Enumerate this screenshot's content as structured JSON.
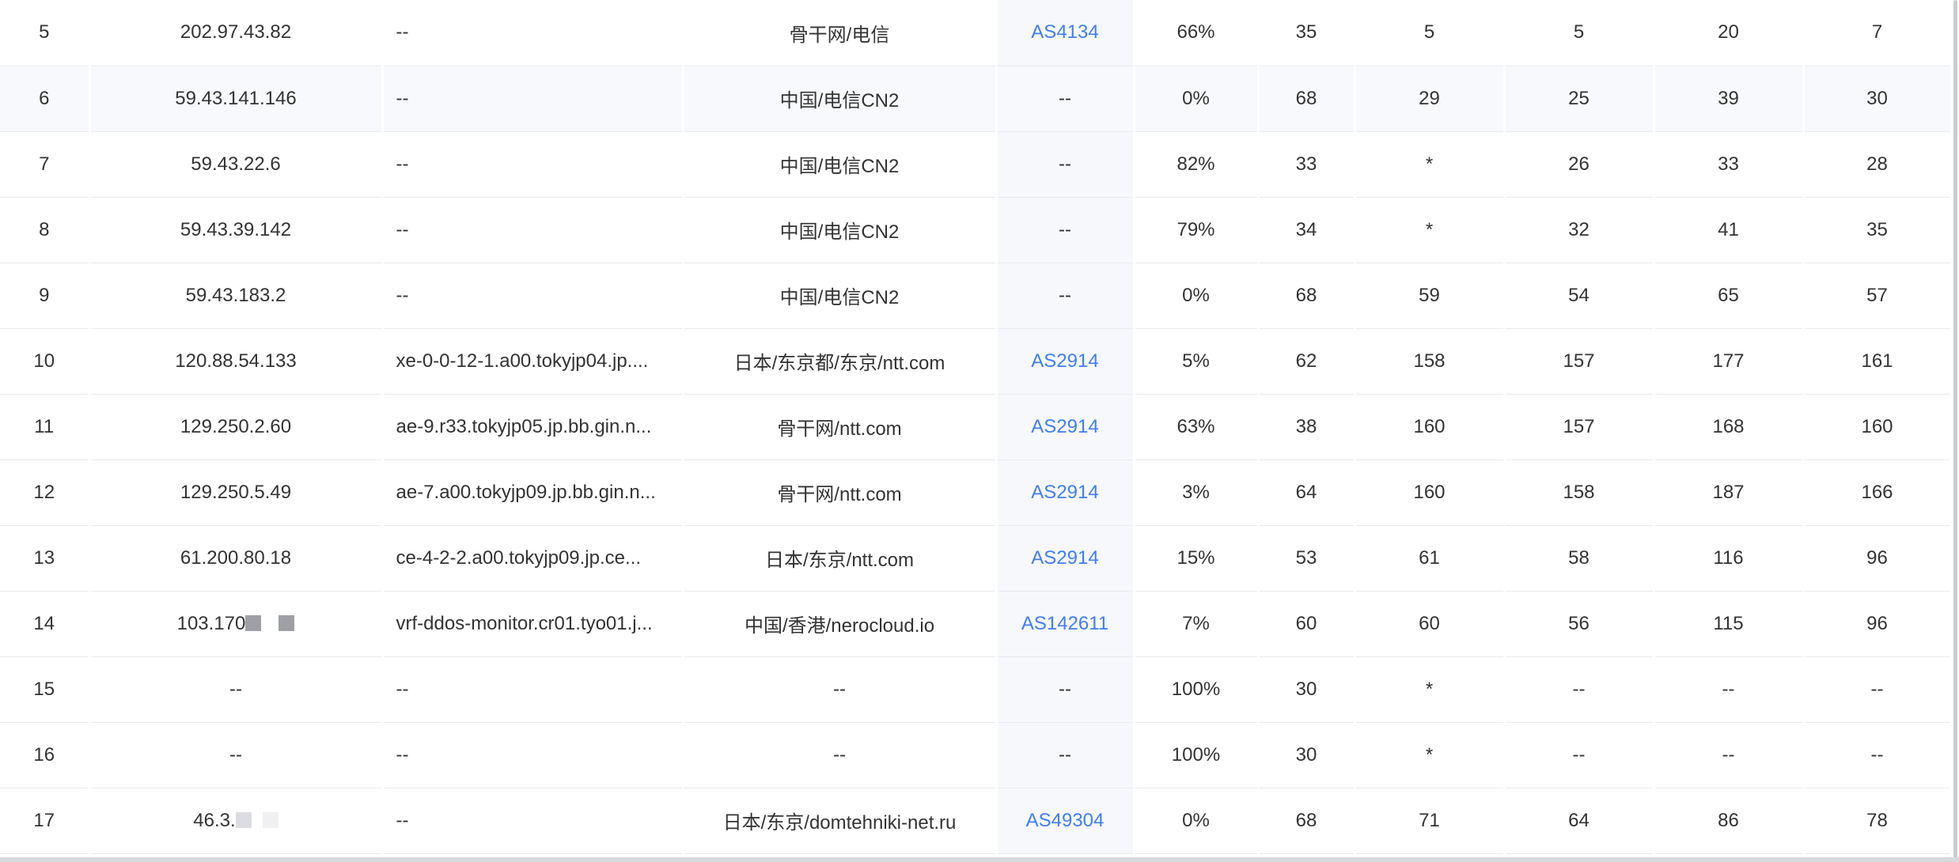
{
  "rows": [
    {
      "hop": "5",
      "ip": "202.97.43.82",
      "host": "--",
      "location": "骨干网/电信",
      "asn": "AS4134",
      "loss": "66%",
      "sent": "35",
      "last": "5",
      "best": "5",
      "worst": "20",
      "avg": "7"
    },
    {
      "hop": "6",
      "ip": "59.43.141.146",
      "host": "--",
      "location": "中国/电信CN2",
      "asn": "--",
      "loss": "0%",
      "sent": "68",
      "last": "29",
      "best": "25",
      "worst": "39",
      "avg": "30"
    },
    {
      "hop": "7",
      "ip": "59.43.22.6",
      "host": "--",
      "location": "中国/电信CN2",
      "asn": "--",
      "loss": "82%",
      "sent": "33",
      "last": "*",
      "best": "26",
      "worst": "33",
      "avg": "28"
    },
    {
      "hop": "8",
      "ip": "59.43.39.142",
      "host": "--",
      "location": "中国/电信CN2",
      "asn": "--",
      "loss": "79%",
      "sent": "34",
      "last": "*",
      "best": "32",
      "worst": "41",
      "avg": "35"
    },
    {
      "hop": "9",
      "ip": "59.43.183.2",
      "host": "--",
      "location": "中国/电信CN2",
      "asn": "--",
      "loss": "0%",
      "sent": "68",
      "last": "59",
      "best": "54",
      "worst": "65",
      "avg": "57"
    },
    {
      "hop": "10",
      "ip": "120.88.54.133",
      "host": "xe-0-0-12-1.a00.tokyjp04.jp....",
      "location": "日本/东京都/东京/ntt.com",
      "asn": "AS2914",
      "loss": "5%",
      "sent": "62",
      "last": "158",
      "best": "157",
      "worst": "177",
      "avg": "161"
    },
    {
      "hop": "11",
      "ip": "129.250.2.60",
      "host": "ae-9.r33.tokyjp05.jp.bb.gin.n...",
      "location": "骨干网/ntt.com",
      "asn": "AS2914",
      "loss": "63%",
      "sent": "38",
      "last": "160",
      "best": "157",
      "worst": "168",
      "avg": "160"
    },
    {
      "hop": "12",
      "ip": "129.250.5.49",
      "host": "ae-7.a00.tokyjp09.jp.bb.gin.n...",
      "location": "骨干网/ntt.com",
      "asn": "AS2914",
      "loss": "3%",
      "sent": "64",
      "last": "160",
      "best": "158",
      "worst": "187",
      "avg": "166"
    },
    {
      "hop": "13",
      "ip": "61.200.80.18",
      "host": "ce-4-2-2.a00.tokyjp09.jp.ce...",
      "location": "日本/东京/ntt.com",
      "asn": "AS2914",
      "loss": "15%",
      "sent": "53",
      "last": "61",
      "best": "58",
      "worst": "116",
      "avg": "96"
    },
    {
      "hop": "14",
      "ip": "103.170",
      "host": "vrf-ddos-monitor.cr01.tyo01.j...",
      "location": "中国/香港/nerocloud.io",
      "asn": "AS142611",
      "loss": "7%",
      "sent": "60",
      "last": "60",
      "best": "56",
      "worst": "115",
      "avg": "96"
    },
    {
      "hop": "15",
      "ip": "--",
      "host": "--",
      "location": "--",
      "asn": "--",
      "loss": "100%",
      "sent": "30",
      "last": "*",
      "best": "--",
      "worst": "--",
      "avg": "--"
    },
    {
      "hop": "16",
      "ip": "--",
      "host": "--",
      "location": "--",
      "asn": "--",
      "loss": "100%",
      "sent": "30",
      "last": "*",
      "best": "--",
      "worst": "--",
      "avg": "--"
    },
    {
      "hop": "17",
      "ip": "46.3.",
      "host": "--",
      "location": "日本/东京/domtehniki-net.ru",
      "asn": "AS49304",
      "loss": "0%",
      "sent": "68",
      "last": "71",
      "best": "64",
      "worst": "86",
      "avg": "78"
    }
  ],
  "colors": {
    "asn_link": "#3f7ef2",
    "row_alt": "#f8f9fc",
    "border": "#e8eaee",
    "text": "#333333"
  }
}
